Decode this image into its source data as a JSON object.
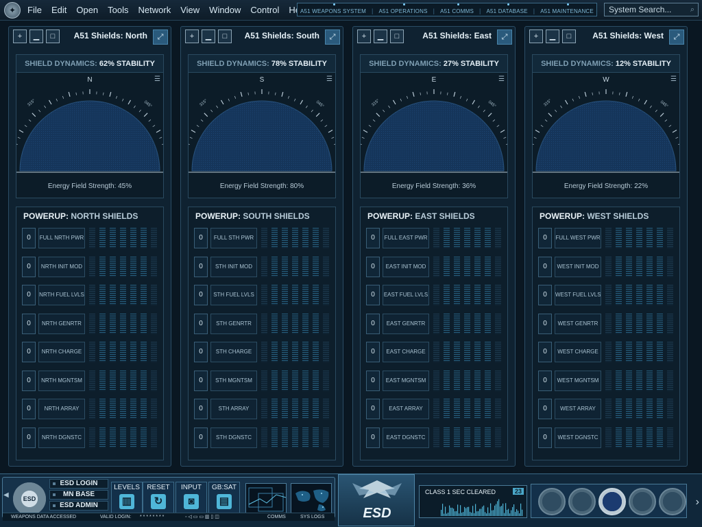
{
  "menubar": {
    "items": [
      "File",
      "Edit",
      "Open",
      "Tools",
      "Network",
      "View",
      "Window",
      "Control",
      "Help"
    ],
    "systems": [
      "A51 WEAPONS SYSTEM",
      "A51 OPERATIONS",
      "A51 COMMS",
      "A51 DATABASE",
      "A51 MAINTENANCE"
    ],
    "search_placeholder": "System Search...",
    "search_icon": "magnifier-icon"
  },
  "panels": [
    {
      "title": "A51 Shields: North",
      "dyn_prefix": "SHIELD DYNAMICS: ",
      "stability": "62% STABILITY",
      "dial_letter": "N",
      "tick_left": "315°",
      "tick_right": "045°",
      "efs_label": "Energy Field Strength: ",
      "efs_value": "45%",
      "efs_fraction": 0.45,
      "powerup_prefix": "POWERUP: ",
      "powerup_name": "NORTH SHIELDS",
      "rows": [
        {
          "value": "0",
          "label": "FULL NRTH PWR"
        },
        {
          "value": "0",
          "label": "NRTH INIT MOD"
        },
        {
          "value": "0",
          "label": "NRTH FUEL LVLS"
        },
        {
          "value": "0",
          "label": "NRTH GENRTR"
        },
        {
          "value": "0",
          "label": "NRTH CHARGE"
        },
        {
          "value": "0",
          "label": "NRTH MGNTSM"
        },
        {
          "value": "0",
          "label": "NRTH ARRAY"
        },
        {
          "value": "0",
          "label": "NRTH DGNSTC"
        }
      ]
    },
    {
      "title": "A51 Shields: South",
      "dyn_prefix": "SHIELD DYNAMICS: ",
      "stability": "78% STABILITY",
      "dial_letter": "S",
      "tick_left": "315°",
      "tick_right": "045°",
      "efs_label": "Energy Field Strength: ",
      "efs_value": "80%",
      "efs_fraction": 0.8,
      "powerup_prefix": "POWERUP: ",
      "powerup_name": "SOUTH SHIELDS",
      "rows": [
        {
          "value": "0",
          "label": "FULL STH PWR"
        },
        {
          "value": "0",
          "label": "STH INIT MOD"
        },
        {
          "value": "0",
          "label": "STH FUEL LVLS"
        },
        {
          "value": "0",
          "label": "STH GENRTR"
        },
        {
          "value": "0",
          "label": "STH CHARGE"
        },
        {
          "value": "0",
          "label": "STH MGNTSM"
        },
        {
          "value": "0",
          "label": "STH ARRAY"
        },
        {
          "value": "0",
          "label": "STH DGNSTC"
        }
      ]
    },
    {
      "title": "A51 Shields: East",
      "dyn_prefix": "SHIELD DYNAMICS: ",
      "stability": "27% STABILITY",
      "dial_letter": "E",
      "tick_left": "315°",
      "tick_right": "045°",
      "efs_label": "Energy Field Strength: ",
      "efs_value": "36%",
      "efs_fraction": 0.36,
      "powerup_prefix": "POWERUP: ",
      "powerup_name": "EAST SHIELDS",
      "rows": [
        {
          "value": "0",
          "label": "FULL EAST PWR"
        },
        {
          "value": "0",
          "label": "EAST INIT MOD"
        },
        {
          "value": "0",
          "label": "EAST FUEL LVLS"
        },
        {
          "value": "0",
          "label": "EAST GENRTR"
        },
        {
          "value": "0",
          "label": "EAST CHARGE"
        },
        {
          "value": "0",
          "label": "EAST MGNTSM"
        },
        {
          "value": "0",
          "label": "EAST ARRAY"
        },
        {
          "value": "0",
          "label": "EAST DGNSTC"
        }
      ]
    },
    {
      "title": "A51 Shields: West",
      "dyn_prefix": "SHIELD DYNAMICS: ",
      "stability": "12% STABILITY",
      "dial_letter": "W",
      "tick_left": "315°",
      "tick_right": "045°",
      "efs_label": "Energy Field Strength: ",
      "efs_value": "22%",
      "efs_fraction": 0.22,
      "powerup_prefix": "POWERUP: ",
      "powerup_name": "WEST SHIELDS",
      "rows": [
        {
          "value": "0",
          "label": "FULL WEST PWR"
        },
        {
          "value": "0",
          "label": "WEST INIT MOD"
        },
        {
          "value": "0",
          "label": "WEST FUEL LVLS"
        },
        {
          "value": "0",
          "label": "WEST GENRTR"
        },
        {
          "value": "0",
          "label": "WEST CHARGE"
        },
        {
          "value": "0",
          "label": "WEST MGNTSM"
        },
        {
          "value": "0",
          "label": "WEST ARRAY"
        },
        {
          "value": "0",
          "label": "WEST DGNSTC"
        }
      ]
    }
  ],
  "dock": {
    "seal_text": "ESD",
    "esd_login": "ESD LOGIN",
    "mn_base": "MN BASE",
    "esd_admin": "ESD ADMIN",
    "tools": [
      {
        "label": "LEVELS",
        "icon": "levels-icon",
        "glyph": "▥"
      },
      {
        "label": "RESET",
        "icon": "reset-icon",
        "glyph": "↻"
      },
      {
        "label": "INPUT",
        "icon": "input-icon",
        "glyph": "◙"
      },
      {
        "label": "GB:SAT",
        "icon": "satellite-icon",
        "glyph": "▤"
      }
    ],
    "status_weapons": "WEAPONS DATA ACCESSED",
    "valid_login": "VALID LOGIN:",
    "password_mask": "* * * * * * * *",
    "comms": "COMMS",
    "sys_logs": "SYS LOGS",
    "esd_logo": "ESD",
    "clearance": "CLASS 1 SEC CLEARED",
    "clearance_num": "23",
    "colors": {
      "accent": "#4fb6d8",
      "panel": "#0f2231",
      "border": "#2b4d66"
    }
  }
}
